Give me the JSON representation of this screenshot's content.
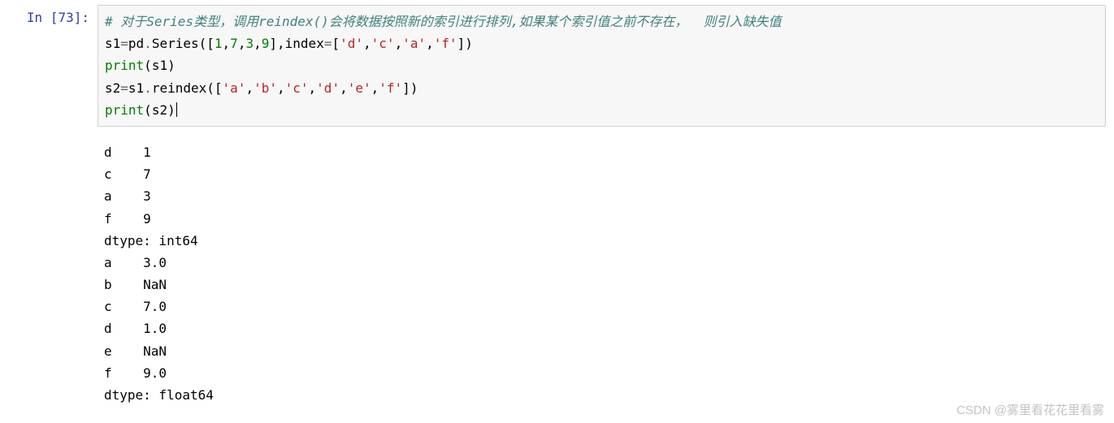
{
  "prompt": {
    "label_in": "In ",
    "bracket_open": "[",
    "number": "73",
    "bracket_close": "]:"
  },
  "code": {
    "comment": "# 对于Series类型，调用reindex()会将数据按照新的索引进行排列,如果某个索引值之前不存在，  则引入缺失值",
    "l2": {
      "a": "s1",
      "eq": "=",
      "b": "pd",
      "dot": ".",
      "c": "Series",
      "p1": "(",
      "br1": "[",
      "n1": "1",
      "cm1": ",",
      "n2": "7",
      "cm2": ",",
      "n3": "3",
      "cm3": ",",
      "n4": "9",
      "br2": "]",
      "cm4": ",",
      "d": "index",
      "eq2": "=",
      "br3": "[",
      "s1": "'d'",
      "cm5": ",",
      "s2": "'c'",
      "cm6": ",",
      "s3": "'a'",
      "cm7": ",",
      "s4": "'f'",
      "br4": "]",
      "p2": ")"
    },
    "l3": {
      "print": "print",
      "p1": "(",
      "a": "s1",
      "p2": ")"
    },
    "l4": {
      "a": "s2",
      "eq": "=",
      "b": "s1",
      "dot": ".",
      "c": "reindex",
      "p1": "(",
      "br1": "[",
      "s1": "'a'",
      "cm1": ",",
      "s2": "'b'",
      "cm2": ",",
      "s3": "'c'",
      "cm3": ",",
      "s4": "'d'",
      "cm4": ",",
      "s5": "'e'",
      "cm5": ",",
      "s6": "'f'",
      "br2": "]",
      "p2": ")"
    },
    "l5": {
      "print": "print",
      "p1": "(",
      "a": "s2",
      "p2": ")"
    }
  },
  "output": "d    1\nc    7\na    3\nf    9\ndtype: int64\na    3.0\nb    NaN\nc    7.0\nd    1.0\ne    NaN\nf    9.0\ndtype: float64",
  "watermark": "CSDN @雾里看花花里看雾"
}
